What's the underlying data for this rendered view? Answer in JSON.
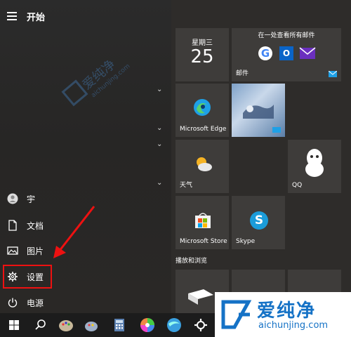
{
  "menu": {
    "title": "开始"
  },
  "nav": {
    "user": "宇",
    "documents": "文档",
    "pictures": "图片",
    "settings": "设置",
    "power": "电源"
  },
  "tiles": {
    "calendar_weekday": "星期三",
    "calendar_day": "25",
    "mail_heading": "在一处查看所有邮件",
    "mail_label": "邮件",
    "edge": "Microsoft Edge",
    "weather": "天气",
    "qq": "QQ",
    "store": "Microsoft Store",
    "skype": "Skype",
    "group_play": "播放和浏览"
  },
  "watermark": {
    "cn": "爱纯净",
    "url": "aichunjing.com"
  },
  "colors": {
    "highlight": "#e11",
    "edge_blue": "#1ea0e6",
    "skype_blue": "#1b9cd9",
    "tile_bg": "#3e3c3a"
  }
}
